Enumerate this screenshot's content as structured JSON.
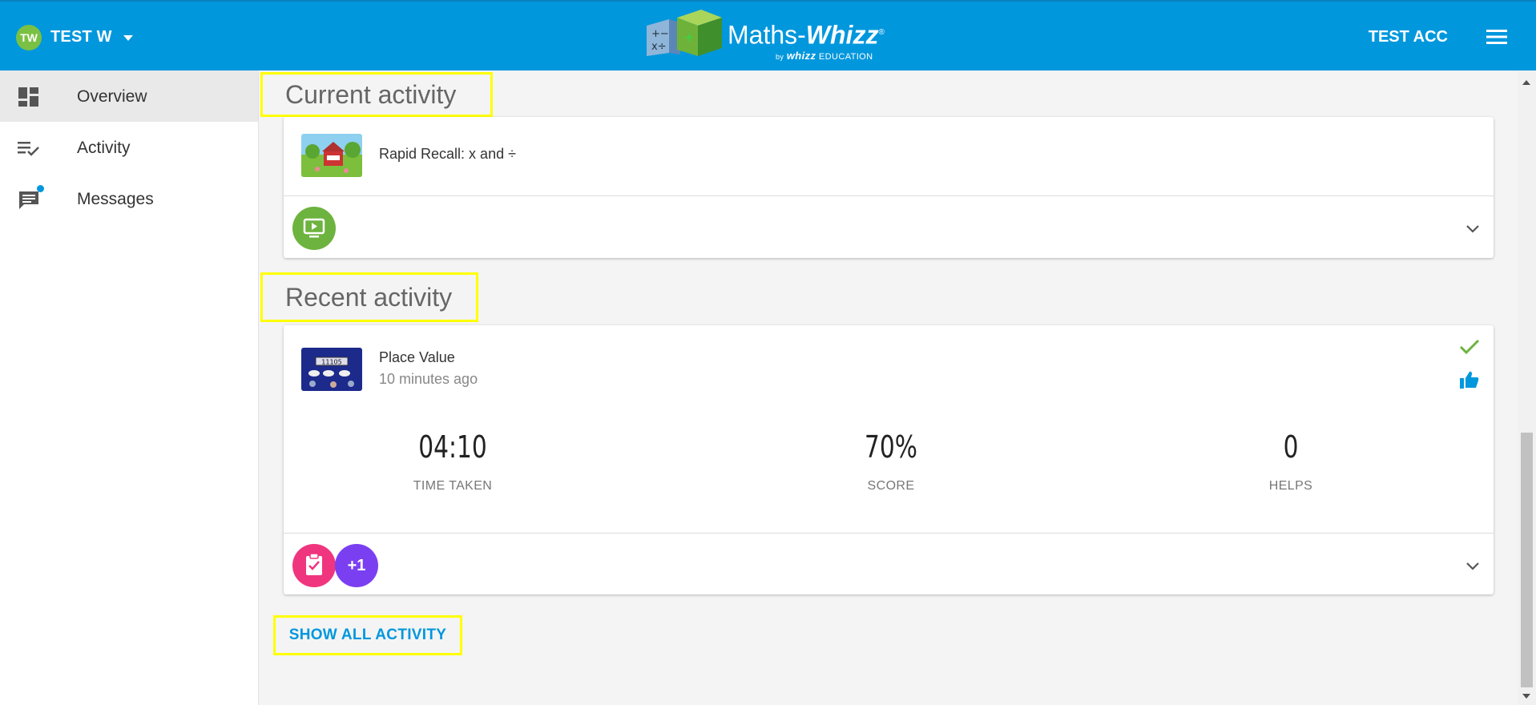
{
  "header": {
    "user_initials": "TW",
    "user_name": "TEST W",
    "logo_main": "Maths-",
    "logo_emph": "Whizz",
    "logo_reg": "®",
    "logo_by": "by",
    "logo_brand": "whizz",
    "logo_edu": "EDUCATION",
    "account_name": "TEST ACC"
  },
  "sidebar": {
    "items": [
      {
        "label": "Overview",
        "icon": "dashboard-icon",
        "active": true
      },
      {
        "label": "Activity",
        "icon": "activity-list-icon",
        "active": false
      },
      {
        "label": "Messages",
        "icon": "message-icon",
        "active": false
      }
    ]
  },
  "current_activity": {
    "title": "Current activity",
    "lesson_name": "Rapid Recall: x and ÷"
  },
  "recent_activity": {
    "title": "Recent activity",
    "lesson_name": "Place Value",
    "time_ago": "10 minutes ago",
    "thumb_text": "11105",
    "stats": [
      {
        "value": "04:10",
        "label": "TIME TAKEN"
      },
      {
        "value": "70%",
        "label": "SCORE"
      },
      {
        "value": "0",
        "label": "HELPS"
      }
    ],
    "plus_badge": "+1"
  },
  "show_all_label": "SHOW ALL ACTIVITY",
  "colors": {
    "brand_blue": "#0097dd",
    "avatar_green": "#7ac143",
    "play_green": "#6db33f",
    "test_pink": "#f0357f",
    "plus_purple": "#7b3ff2",
    "highlight_yellow": "#ffff00"
  }
}
